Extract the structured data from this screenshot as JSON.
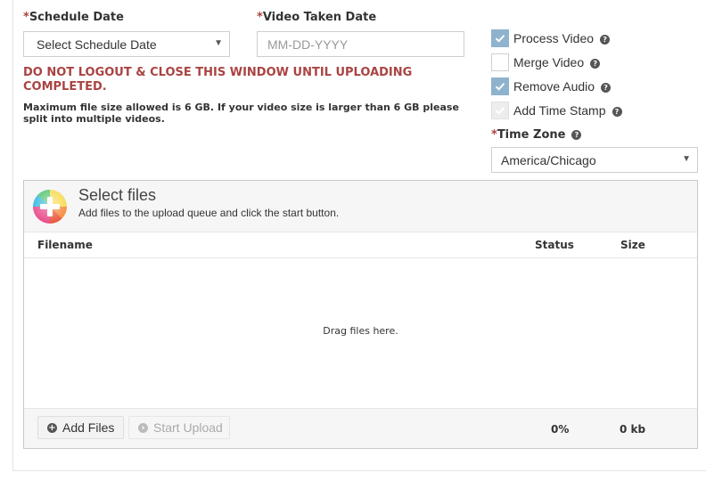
{
  "schedule_date": {
    "required_mark": "*",
    "label": "Schedule Date",
    "selected": "Select Schedule Date"
  },
  "video_taken_date": {
    "required_mark": "*",
    "label": "Video Taken Date",
    "placeholder": "MM-DD-YYYY"
  },
  "warning": "DO NOT LOGOUT & CLOSE THIS WINDOW UNTIL UPLOADING COMPLETED.",
  "size_note": "Maximum file size allowed is 6 GB. If your video size is larger than 6 GB please split into multiple videos.",
  "options": [
    {
      "label": "Process Video",
      "checked": true,
      "disabled": false
    },
    {
      "label": "Merge Video",
      "checked": false,
      "disabled": false
    },
    {
      "label": "Remove Audio",
      "checked": true,
      "disabled": false
    },
    {
      "label": "Add Time Stamp",
      "checked": true,
      "disabled": true
    }
  ],
  "time_zone": {
    "required_mark": "*",
    "label": "Time Zone",
    "selected": "America/Chicago"
  },
  "uploader": {
    "title": "Select files",
    "subtitle": "Add files to the upload queue and click the start button.",
    "columns": {
      "filename": "Filename",
      "status": "Status",
      "size": "Size"
    },
    "drop_text": "Drag files here.",
    "add_files_label": "Add Files",
    "start_upload_label": "Start Upload",
    "total_status": "0%",
    "total_size": "0 kb"
  },
  "colors": {
    "required": "#a94442",
    "checkbox_checked": "#8fb3cc"
  },
  "icons": {
    "help": "question-circle-icon",
    "add": "plus-circle-icon",
    "start": "arrow-circle-right-icon",
    "dropdown": "caret-down-icon",
    "checked": "checkmark-icon",
    "uploader": "rainbow-plus-icon"
  }
}
